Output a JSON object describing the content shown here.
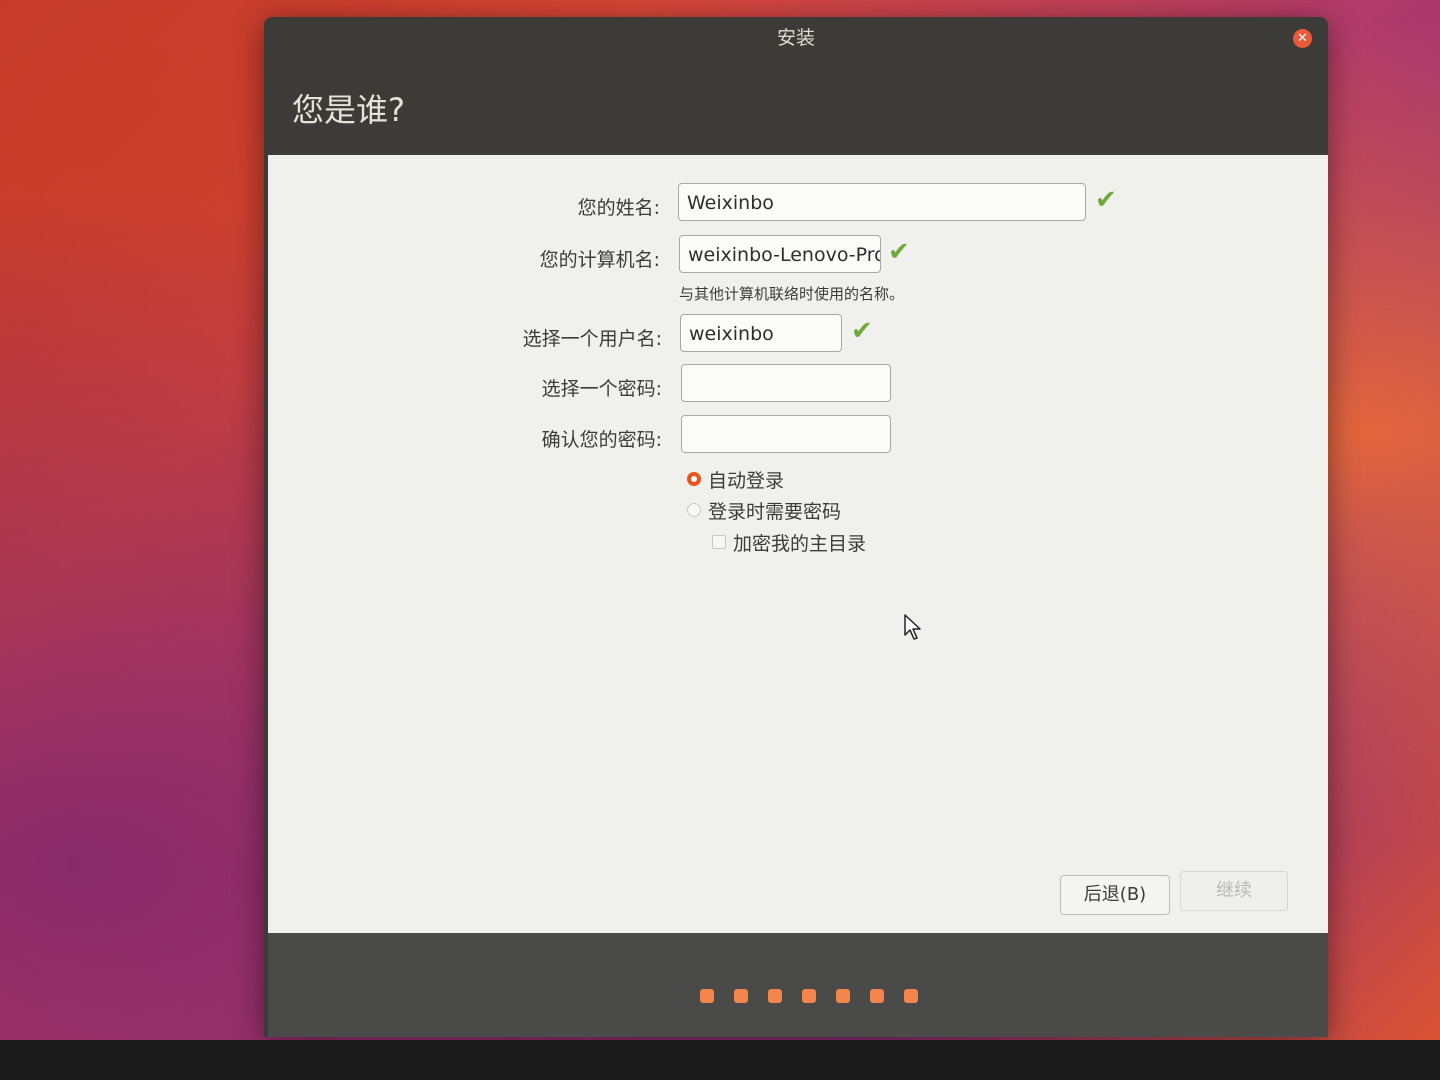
{
  "window": {
    "title": "安装",
    "page_title": "您是谁?"
  },
  "form": {
    "name_label": "您的姓名:",
    "name_value": "Weixinbo",
    "computer_label": "您的计算机名:",
    "computer_value": "weixinbo-Lenovo-Prod",
    "computer_hint": "与其他计算机联络时使用的名称。",
    "username_label": "选择一个用户名:",
    "username_value": "weixinbo",
    "password_label": "选择一个密码:",
    "password_value": "",
    "confirm_label": "确认您的密码:",
    "confirm_value": "",
    "valid_mark": "✔"
  },
  "login_options": {
    "auto_login": "自动登录",
    "require_password": "登录时需要密码",
    "encrypt_home": "加密我的主目录",
    "selected": "auto_login"
  },
  "buttons": {
    "back": "后退(B)",
    "continue": "继续"
  },
  "progress": {
    "steps": 7
  },
  "colors": {
    "accent": "#e95420",
    "check": "#6ea93a",
    "progress_dot": "#f3844c"
  }
}
